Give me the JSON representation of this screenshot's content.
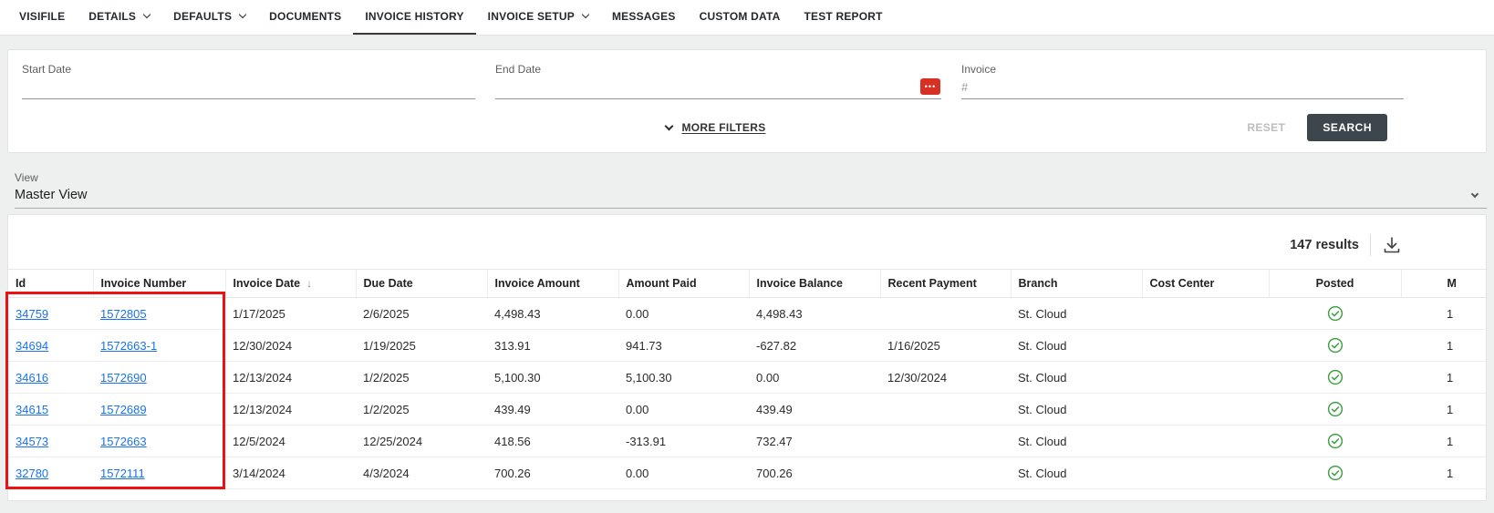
{
  "nav": {
    "tabs": [
      {
        "label": "VISIFILE",
        "dropdown": false,
        "active": false
      },
      {
        "label": "DETAILS",
        "dropdown": true,
        "active": false
      },
      {
        "label": "DEFAULTS",
        "dropdown": true,
        "active": false
      },
      {
        "label": "DOCUMENTS",
        "dropdown": false,
        "active": false
      },
      {
        "label": "INVOICE HISTORY",
        "dropdown": false,
        "active": true
      },
      {
        "label": "INVOICE SETUP",
        "dropdown": true,
        "active": false
      },
      {
        "label": "MESSAGES",
        "dropdown": false,
        "active": false
      },
      {
        "label": "CUSTOM DATA",
        "dropdown": false,
        "active": false
      },
      {
        "label": "TEST REPORT",
        "dropdown": false,
        "active": false
      }
    ]
  },
  "filters": {
    "start_date_label": "Start Date",
    "start_date_value": "",
    "end_date_label": "End Date",
    "end_date_value": "",
    "invoice_label": "Invoice",
    "invoice_placeholder": "#",
    "invoice_value": "",
    "date_badge_glyph": "•••",
    "more_filters_label": "MORE FILTERS",
    "reset_label": "RESET",
    "search_label": "SEARCH"
  },
  "view": {
    "label": "View",
    "value": "Master View"
  },
  "results": {
    "count_text": "147 results"
  },
  "table": {
    "sort_glyph": "↓",
    "columns": [
      "Id",
      "Invoice Number",
      "Invoice Date",
      "Due Date",
      "Invoice Amount",
      "Amount Paid",
      "Invoice Balance",
      "Recent Payment",
      "Branch",
      "Cost Center",
      "Posted",
      "M"
    ],
    "rows": [
      {
        "id": "34759",
        "invoice_number": "1572805",
        "invoice_date": "1/17/2025",
        "due_date": "2/6/2025",
        "invoice_amount": "4,498.43",
        "amount_paid": "0.00",
        "invoice_balance": "4,498.43",
        "recent_payment": "",
        "branch": "St. Cloud",
        "cost_center": "",
        "posted": true,
        "m": "1"
      },
      {
        "id": "34694",
        "invoice_number": "1572663-1",
        "invoice_date": "12/30/2024",
        "due_date": "1/19/2025",
        "invoice_amount": "313.91",
        "amount_paid": "941.73",
        "invoice_balance": "-627.82",
        "recent_payment": "1/16/2025",
        "branch": "St. Cloud",
        "cost_center": "",
        "posted": true,
        "m": "1"
      },
      {
        "id": "34616",
        "invoice_number": "1572690",
        "invoice_date": "12/13/2024",
        "due_date": "1/2/2025",
        "invoice_amount": "5,100.30",
        "amount_paid": "5,100.30",
        "invoice_balance": "0.00",
        "recent_payment": "12/30/2024",
        "branch": "St. Cloud",
        "cost_center": "",
        "posted": true,
        "m": "1"
      },
      {
        "id": "34615",
        "invoice_number": "1572689",
        "invoice_date": "12/13/2024",
        "due_date": "1/2/2025",
        "invoice_amount": "439.49",
        "amount_paid": "0.00",
        "invoice_balance": "439.49",
        "recent_payment": "",
        "branch": "St. Cloud",
        "cost_center": "",
        "posted": true,
        "m": "1"
      },
      {
        "id": "34573",
        "invoice_number": "1572663",
        "invoice_date": "12/5/2024",
        "due_date": "12/25/2024",
        "invoice_amount": "418.56",
        "amount_paid": "-313.91",
        "invoice_balance": "732.47",
        "recent_payment": "",
        "branch": "St. Cloud",
        "cost_center": "",
        "posted": true,
        "m": "1"
      },
      {
        "id": "32780",
        "invoice_number": "1572111",
        "invoice_date": "3/14/2024",
        "due_date": "4/3/2024",
        "invoice_amount": "700.26",
        "amount_paid": "0.00",
        "invoice_balance": "700.26",
        "recent_payment": "",
        "branch": "St. Cloud",
        "cost_center": "",
        "posted": true,
        "m": "1"
      }
    ]
  },
  "colors": {
    "link": "#1a73e8",
    "btn-dark": "#3d464d",
    "green": "#43a047",
    "red-badge": "#d93025",
    "annotation": "#ee1111",
    "active-tab": "#3a3a3a"
  }
}
